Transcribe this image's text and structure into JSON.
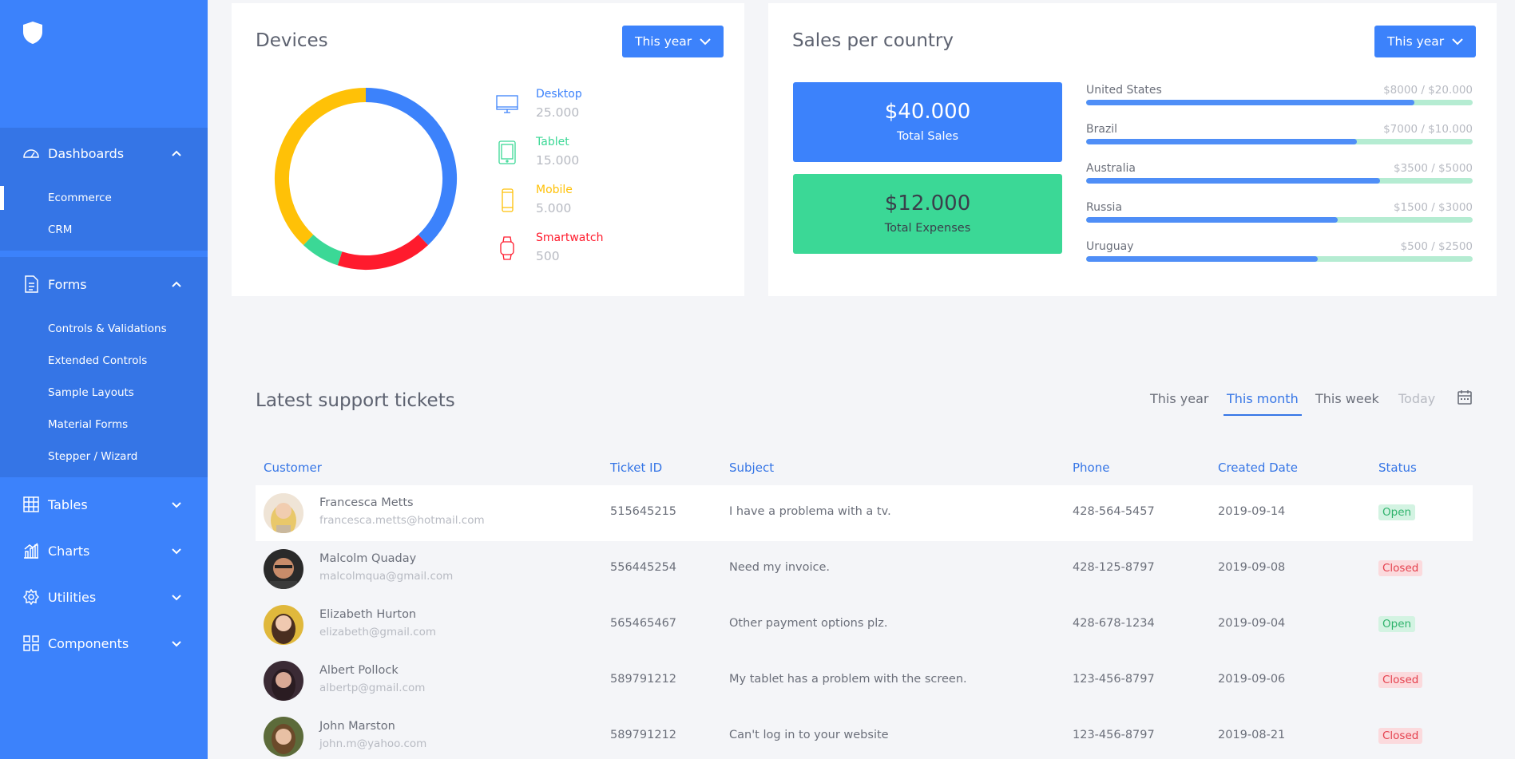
{
  "sidebar": {
    "groups": [
      {
        "label": "Dashboards",
        "icon": "gauge-icon",
        "expanded": true,
        "items": [
          {
            "label": "Ecommerce",
            "active": true
          },
          {
            "label": "CRM"
          }
        ]
      },
      {
        "label": "Forms",
        "icon": "document-icon",
        "expanded": true,
        "items": [
          {
            "label": "Controls & Validations"
          },
          {
            "label": "Extended Controls"
          },
          {
            "label": "Sample Layouts"
          },
          {
            "label": "Material Forms"
          },
          {
            "label": "Stepper / Wizard"
          }
        ]
      },
      {
        "label": "Tables",
        "icon": "table-icon",
        "expanded": false
      },
      {
        "label": "Charts",
        "icon": "bar-chart-icon",
        "expanded": false
      },
      {
        "label": "Utilities",
        "icon": "gear-icon",
        "expanded": false
      },
      {
        "label": "Components",
        "icon": "grid-icon",
        "expanded": false
      }
    ]
  },
  "devices": {
    "title": "Devices",
    "period_button": "This year",
    "items": [
      {
        "label": "Desktop",
        "value": "25.000",
        "color": "#3c82fb",
        "icon": "desktop-icon"
      },
      {
        "label": "Tablet",
        "value": "15.000",
        "color": "#3bd896",
        "icon": "tablet-icon"
      },
      {
        "label": "Mobile",
        "value": "5.000",
        "color": "#ffc107",
        "icon": "mobile-icon"
      },
      {
        "label": "Smartwatch",
        "value": "500",
        "color": "#ff1b2d",
        "icon": "smartwatch-icon"
      }
    ]
  },
  "chart_data": {
    "type": "pie",
    "labels": [
      "Desktop",
      "Smartwatch",
      "Tablet",
      "Mobile"
    ],
    "values": [
      38,
      17,
      7,
      38
    ],
    "colors": [
      "#3c82fb",
      "#ff1b2d",
      "#3bd896",
      "#ffc107"
    ]
  },
  "sales": {
    "title": "Sales per country",
    "period_button": "This year",
    "total_sales": {
      "amount": "$40.000",
      "label": "Total Sales"
    },
    "total_expenses": {
      "amount": "$12.000",
      "label": "Total Expenses"
    },
    "countries": [
      {
        "name": "United States",
        "value_text": "$8000 / $20.000",
        "progress": 0.85
      },
      {
        "name": "Brazil",
        "value_text": "$7000 / $10.000",
        "progress": 0.7
      },
      {
        "name": "Australia",
        "value_text": "$3500 / $5000",
        "progress": 0.76
      },
      {
        "name": "Russia",
        "value_text": "$1500 / $3000",
        "progress": 0.65
      },
      {
        "name": "Uruguay",
        "value_text": "$500 / $2500",
        "progress": 0.6
      }
    ]
  },
  "tickets": {
    "title": "Latest support tickets",
    "tabs": [
      {
        "label": "This year",
        "active": false
      },
      {
        "label": "This month",
        "active": true
      },
      {
        "label": "This week",
        "active": false
      },
      {
        "label": "Today",
        "active": false,
        "muted": true
      }
    ],
    "columns": [
      "Customer",
      "Ticket ID",
      "Subject",
      "Phone",
      "Created Date",
      "Status"
    ],
    "rows": [
      {
        "name": "Francesca Metts",
        "email": "francesca.metts@hotmail.com",
        "ticket_id": "515645215",
        "subject": "I have a problema with a tv.",
        "phone": "428-564-5457",
        "date": "2019-09-14",
        "status": "Open"
      },
      {
        "name": "Malcolm Quaday",
        "email": "malcolmqua@gmail.com",
        "ticket_id": "556445254",
        "subject": "Need my invoice.",
        "phone": "428-125-8797",
        "date": "2019-09-08",
        "status": "Closed"
      },
      {
        "name": "Elizabeth Hurton",
        "email": "elizabeth@gmail.com",
        "ticket_id": "565465467",
        "subject": "Other payment options plz.",
        "phone": "428-678-1234",
        "date": "2019-09-04",
        "status": "Open"
      },
      {
        "name": "Albert Pollock",
        "email": "albertp@gmail.com",
        "ticket_id": "589791212",
        "subject": "My tablet has a problem with the screen.",
        "phone": "123-456-8797",
        "date": "2019-09-06",
        "status": "Closed"
      },
      {
        "name": "John Marston",
        "email": "john.m@yahoo.com",
        "ticket_id": "589791212",
        "subject": "Can't log in to your website",
        "phone": "123-456-8797",
        "date": "2019-08-21",
        "status": "Closed"
      }
    ]
  }
}
